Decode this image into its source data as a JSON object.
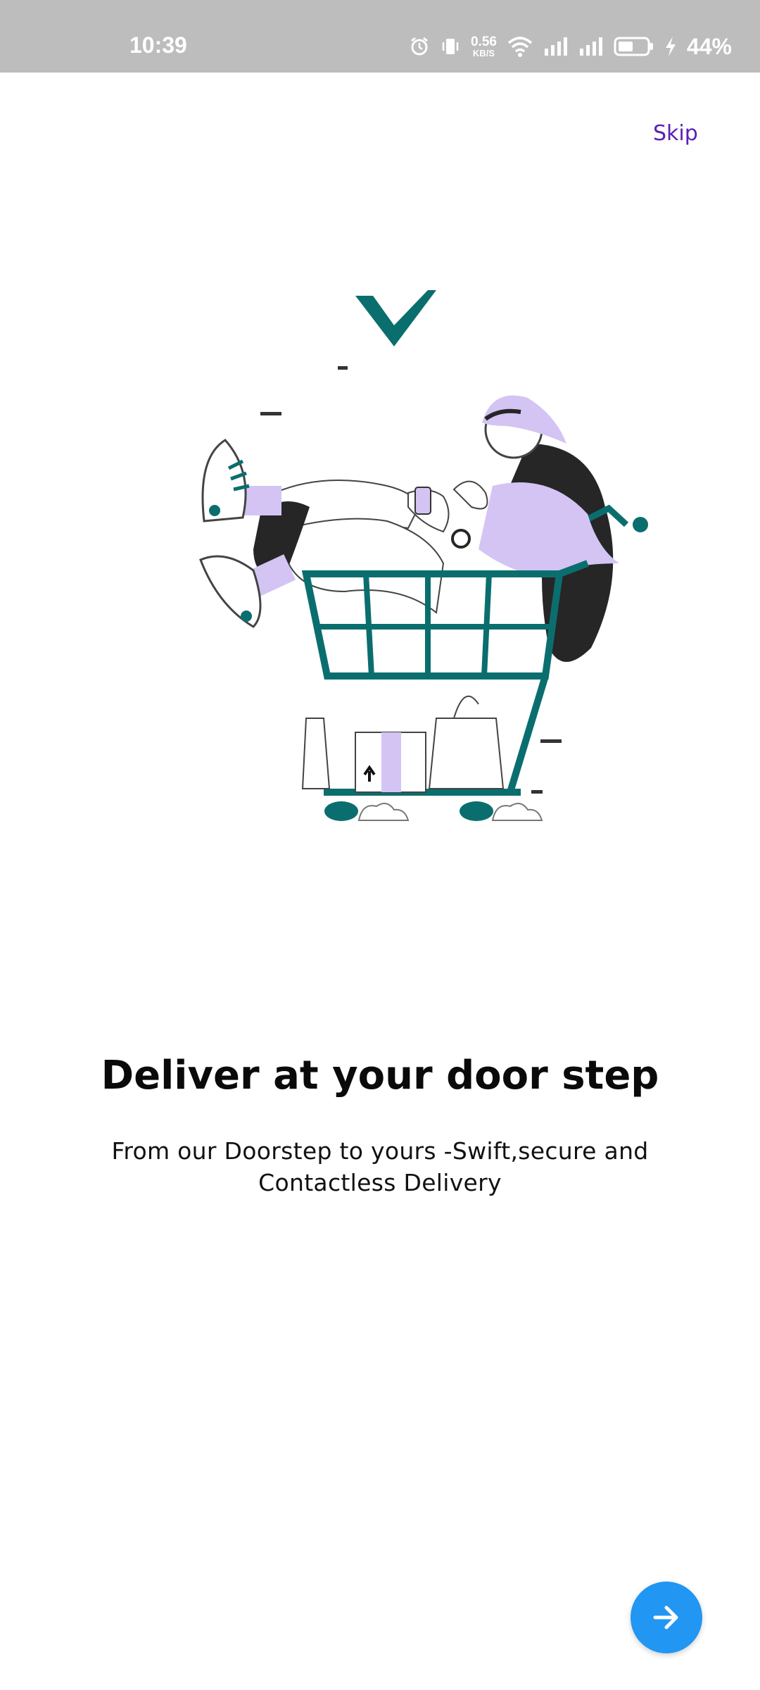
{
  "status_bar": {
    "time": "10:39",
    "net_speed_value": "0.56",
    "net_speed_unit": "KB/S",
    "battery_percent": "44%",
    "icons": [
      "alarm-icon",
      "vibrate-icon",
      "wifi-icon",
      "signal-icon",
      "signal-icon",
      "battery-icon",
      "charging-icon"
    ]
  },
  "onboarding": {
    "skip_label": "Skip",
    "title": "Deliver at your door step",
    "subtitle": "From our Doorstep to yours -Swift,secure and Contactless Delivery",
    "next_icon": "arrow-right-icon"
  },
  "colors": {
    "accent": "#2196f3",
    "skip_text": "#5b21b6",
    "teal": "#0b6e6e",
    "lavender": "#d4c4f4",
    "status_bar": "#bdbdbd"
  }
}
